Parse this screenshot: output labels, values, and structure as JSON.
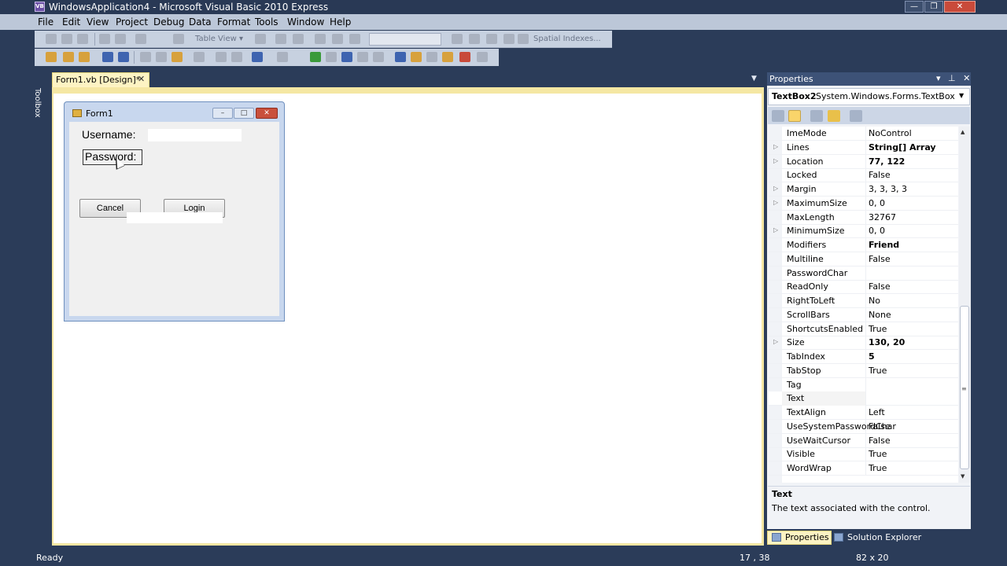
{
  "window": {
    "title": "WindowsApplication4 - Microsoft Visual Basic 2010 Express",
    "app_icon_text": "VB",
    "min": "—",
    "max": "❐",
    "close": "✕"
  },
  "menu": [
    "File",
    "Edit",
    "View",
    "Project",
    "Debug",
    "Data",
    "Format",
    "Tools",
    "Window",
    "Help"
  ],
  "toolbar": {
    "table_view": "Table View ▾",
    "spatial": "Spatial Indexes..."
  },
  "toolbox_label": "Toolbox",
  "document_tab": {
    "label": "Form1.vb [Design]*",
    "close": "✕",
    "dropdown": "▼"
  },
  "form1": {
    "title": "Form1",
    "username_label": "Username:",
    "password_label": "Password:",
    "cancel_button": "Cancel",
    "login_button": "Login",
    "min": "–",
    "max": "□",
    "close": "✕"
  },
  "properties": {
    "title": "Properties",
    "header_icons": "▾ ⊥ ✕",
    "object_name": "TextBox2",
    "object_type": "System.Windows.Forms.TextBox",
    "rows": [
      {
        "name": "ImeMode",
        "value": "NoControl",
        "bold": false,
        "expandable": false
      },
      {
        "name": "Lines",
        "value": "String[] Array",
        "bold": true,
        "expandable": true
      },
      {
        "name": "Location",
        "value": "77, 122",
        "bold": true,
        "expandable": true
      },
      {
        "name": "Locked",
        "value": "False",
        "bold": false,
        "expandable": false
      },
      {
        "name": "Margin",
        "value": "3, 3, 3, 3",
        "bold": false,
        "expandable": true
      },
      {
        "name": "MaximumSize",
        "value": "0, 0",
        "bold": false,
        "expandable": true
      },
      {
        "name": "MaxLength",
        "value": "32767",
        "bold": false,
        "expandable": false
      },
      {
        "name": "MinimumSize",
        "value": "0, 0",
        "bold": false,
        "expandable": true
      },
      {
        "name": "Modifiers",
        "value": "Friend",
        "bold": true,
        "expandable": false
      },
      {
        "name": "Multiline",
        "value": "False",
        "bold": false,
        "expandable": false
      },
      {
        "name": "PasswordChar",
        "value": "",
        "bold": false,
        "expandable": false
      },
      {
        "name": "ReadOnly",
        "value": "False",
        "bold": false,
        "expandable": false
      },
      {
        "name": "RightToLeft",
        "value": "No",
        "bold": false,
        "expandable": false
      },
      {
        "name": "ScrollBars",
        "value": "None",
        "bold": false,
        "expandable": false
      },
      {
        "name": "ShortcutsEnabled",
        "value": "True",
        "bold": false,
        "expandable": false
      },
      {
        "name": "Size",
        "value": "130, 20",
        "bold": true,
        "expandable": true
      },
      {
        "name": "TabIndex",
        "value": "5",
        "bold": true,
        "expandable": false
      },
      {
        "name": "TabStop",
        "value": "True",
        "bold": false,
        "expandable": false
      },
      {
        "name": "Tag",
        "value": "",
        "bold": false,
        "expandable": false
      },
      {
        "name": "Text",
        "value": "",
        "bold": false,
        "expandable": false,
        "selected": true
      },
      {
        "name": "TextAlign",
        "value": "Left",
        "bold": false,
        "expandable": false
      },
      {
        "name": "UseSystemPasswordChar",
        "value": "False",
        "bold": false,
        "expandable": false
      },
      {
        "name": "UseWaitCursor",
        "value": "False",
        "bold": false,
        "expandable": false
      },
      {
        "name": "Visible",
        "value": "True",
        "bold": false,
        "expandable": false
      },
      {
        "name": "WordWrap",
        "value": "True",
        "bold": false,
        "expandable": false
      }
    ],
    "description_title": "Text",
    "description_text": "The text associated with the control."
  },
  "bottom_tabs": {
    "properties": "Properties",
    "solution_explorer": "Solution Explorer"
  },
  "status": {
    "text": "Ready",
    "position": "17 , 38",
    "size": "82 x 20"
  }
}
